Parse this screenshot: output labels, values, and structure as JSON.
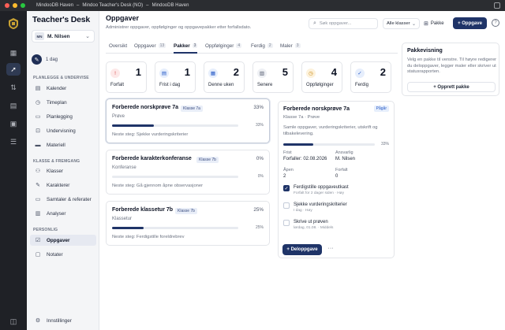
{
  "titlebar": {
    "items": [
      "MindooDB Haven",
      "Mindoo Teacher's Desk (NO)",
      "MindooDB Haven"
    ]
  },
  "brand": {
    "title": "Teacher's Desk"
  },
  "user": {
    "initials": "MN",
    "name": "M. Nilsen"
  },
  "streak": {
    "label": "1 dag"
  },
  "sidebar": {
    "section1": "PLANLEGGE & UNDERVISE",
    "section2": "KLASSE & FREMGANG",
    "section3": "PERSONLIG",
    "items": [
      {
        "label": "Kalender",
        "icon": "calendar-icon"
      },
      {
        "label": "Timeplan",
        "icon": "clock-icon"
      },
      {
        "label": "Planlegging",
        "icon": "plan-icon"
      },
      {
        "label": "Undervisning",
        "icon": "teaching-icon"
      },
      {
        "label": "Materiell",
        "icon": "folder-icon"
      },
      {
        "label": "Klasser",
        "icon": "class-icon"
      },
      {
        "label": "Karakterer",
        "icon": "grade-icon"
      },
      {
        "label": "Samtaler & referater",
        "icon": "chat-icon"
      },
      {
        "label": "Analyser",
        "icon": "chart-icon"
      },
      {
        "label": "Oppgaver",
        "icon": "tasks-icon"
      },
      {
        "label": "Notater",
        "icon": "notes-icon"
      }
    ],
    "settings": "Innstillinger"
  },
  "header": {
    "title": "Oppgaver",
    "subtitle": "Administrer oppgaver, oppfølginger og oppgavepakker etter forfallsdato.",
    "search_placeholder": "Søk oppgaver...",
    "class_select": "Alle klasser",
    "pakke_label": "Pakke",
    "new_label": "Oppgave",
    "help": "?"
  },
  "tabs": [
    {
      "label": "Oversikt",
      "count": ""
    },
    {
      "label": "Oppgaver",
      "count": "13"
    },
    {
      "label": "Pakker",
      "count": "3"
    },
    {
      "label": "Oppfølginger",
      "count": "4"
    },
    {
      "label": "Ferdig",
      "count": "2"
    },
    {
      "label": "Maler",
      "count": "3"
    }
  ],
  "stats": [
    {
      "label": "Forfalt",
      "value": "1",
      "icon": "alert-icon",
      "color": "#d64545",
      "bg": "#fde8e8"
    },
    {
      "label": "Frist i dag",
      "value": "1",
      "icon": "calendar-icon",
      "color": "#2458c6",
      "bg": "#e6eefc"
    },
    {
      "label": "Denne uken",
      "value": "2",
      "icon": "calendar-week-icon",
      "color": "#2458c6",
      "bg": "#e6eefc"
    },
    {
      "label": "Senere",
      "value": "5",
      "icon": "calendar-later-icon",
      "color": "#4b5366",
      "bg": "#eef0f4"
    },
    {
      "label": "Oppfølginger",
      "value": "4",
      "icon": "clock-icon",
      "color": "#c98a12",
      "bg": "#fdf2dc"
    },
    {
      "label": "Ferdig",
      "value": "2",
      "icon": "check-circle-icon",
      "color": "#2458c6",
      "bg": "#e6eefc"
    }
  ],
  "packages": [
    {
      "title": "Forberede norskprøve 7a",
      "class": "Klasse 7a",
      "percent": "33%",
      "progress": 0.33,
      "type": "Prøve",
      "next": "Neste steg: Sjekke vurderingskriterier"
    },
    {
      "title": "Forberede karakterkonferanse",
      "class": "Klasse 7b",
      "percent": "0%",
      "progress": 0,
      "type": "Konferanse",
      "next": "Neste steg: Gå gjennom åpne observasjoner"
    },
    {
      "title": "Forberede klassetur 7b",
      "class": "Klasse 7b",
      "percent": "25%",
      "progress": 0.25,
      "type": "Klassetur",
      "next": "Neste steg: Ferdigstille foreldrebrev"
    }
  ],
  "detail": {
    "title": "Forberede norskprøve 7a",
    "badge": "Pågår",
    "subtitle": "Klasse 7a · Prøve",
    "description": "Samle oppgaver, vurderingskriterier, utskrift og tilbakelevering.",
    "percent": "33%",
    "progress": 0.33,
    "frist_label": "Frist",
    "frist_value": "Forfaller: 02.08.2026",
    "ansvarlig_label": "Ansvarlig",
    "ansvarlig_value": "M. Nilsen",
    "apen_label": "Åpen",
    "apen_value": "2",
    "forfalt_label": "Forfalt",
    "forfalt_value": "0",
    "checklist": [
      {
        "text": "Ferdigstille oppgaveutkast",
        "meta": "Forfalt for 2 dager siden · Høy",
        "done": true
      },
      {
        "text": "Sjekke vurderingskriterier",
        "meta": "I dag · Høy",
        "done": false
      },
      {
        "text": "Skrive ut prøven",
        "meta": "lørdag, 01.08. · Middels",
        "done": false
      }
    ],
    "add_label": "Deloppgave",
    "more": "···"
  },
  "pakkevisning": {
    "title": "Pakkevisning",
    "description": "Velg en pakke til venstre. Til høyre redigerer du deloppgaver, legger maler eller skriver ut statusrapporten.",
    "button": "Opprett pakke"
  },
  "colors": {
    "accent": "#1f3468"
  }
}
